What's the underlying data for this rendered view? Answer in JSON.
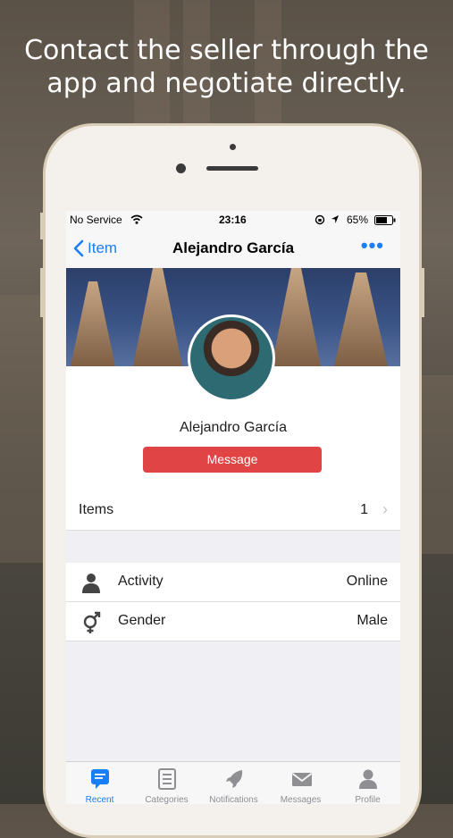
{
  "headline": {
    "line1": "Contact the seller through the",
    "line2": "app and negotiate directly."
  },
  "status_bar": {
    "carrier": "No Service",
    "time": "23:16",
    "battery": "65%"
  },
  "nav": {
    "back_label": "Item",
    "title": "Alejandro García",
    "more": "•••"
  },
  "profile": {
    "name": "Alejandro García",
    "message_label": "Message"
  },
  "items_row": {
    "label": "Items",
    "count": "1"
  },
  "details": [
    {
      "label": "Activity",
      "value": "Online"
    },
    {
      "label": "Gender",
      "value": "Male"
    }
  ],
  "tabs": [
    {
      "label": "Recent",
      "active": true
    },
    {
      "label": "Categories",
      "active": false
    },
    {
      "label": "Notifications",
      "active": false
    },
    {
      "label": "Messages",
      "active": false
    },
    {
      "label": "Profile",
      "active": false
    }
  ],
  "colors": {
    "accent": "#1a7ef5",
    "message_button": "#e04444"
  }
}
